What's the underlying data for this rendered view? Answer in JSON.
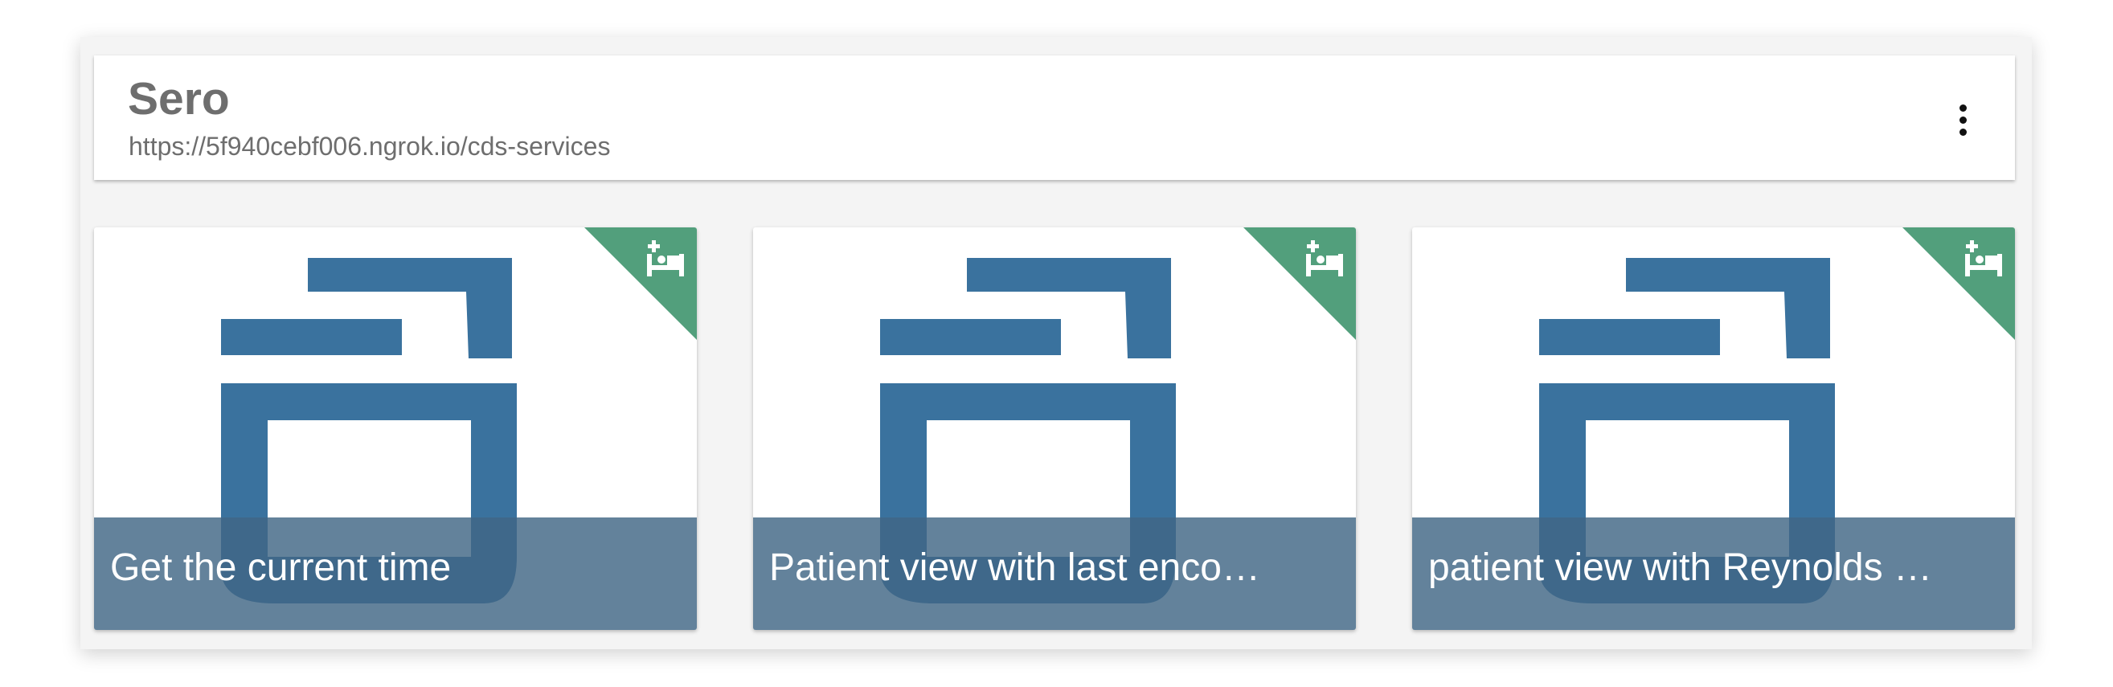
{
  "header": {
    "server_name": "Sero",
    "server_url": "https://5f940cebf006.ngrok.io/cds-services",
    "menu_icon": "more-vert-icon"
  },
  "cards": [
    {
      "title": "Get the current time",
      "hook_icon": "patient-bed-icon"
    },
    {
      "title": "Patient view with last enco…",
      "hook_icon": "patient-bed-icon"
    },
    {
      "title": "patient view with Reynolds …",
      "hook_icon": "patient-bed-icon"
    }
  ],
  "colors": {
    "logo_blue": "#3a729e",
    "corner_green": "#529f7c",
    "caption_overlay": "#416685",
    "panel_bg": "#f4f4f4",
    "header_text": "#6e6e6e"
  }
}
